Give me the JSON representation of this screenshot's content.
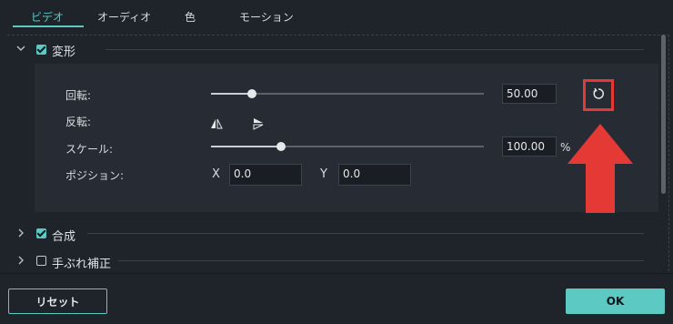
{
  "tabs": [
    {
      "label": "ビデオ",
      "active": true
    },
    {
      "label": "オーディオ",
      "active": false
    },
    {
      "label": "色",
      "active": false
    },
    {
      "label": "モーション",
      "active": false
    }
  ],
  "sections": {
    "transform": {
      "title": "変形",
      "expanded": true,
      "checked": true
    },
    "composite": {
      "title": "合成",
      "expanded": false,
      "checked": true
    },
    "stabilize": {
      "title": "手ぶれ補正",
      "expanded": false,
      "checked": false
    }
  },
  "transform": {
    "rotate": {
      "label": "回転:",
      "value": "50.00",
      "slider_fraction": 0.15
    },
    "flip": {
      "label": "反転:"
    },
    "scale": {
      "label": "スケール:",
      "value": "100.00",
      "unit": "%",
      "slider_fraction": 0.25
    },
    "position": {
      "label": "ポジション:",
      "x_label": "X",
      "x_value": "0.0",
      "y_label": "Y",
      "y_value": "0.0"
    }
  },
  "buttons": {
    "reset": "リセット",
    "ok": "OK"
  },
  "colors": {
    "accent": "#5cc9c3",
    "highlight": "#e53935",
    "background": "#1f242b"
  },
  "icons": {
    "reset": "rotate-reset-icon",
    "flip_h": "flip-horizontal-icon",
    "flip_v": "flip-vertical-icon"
  }
}
